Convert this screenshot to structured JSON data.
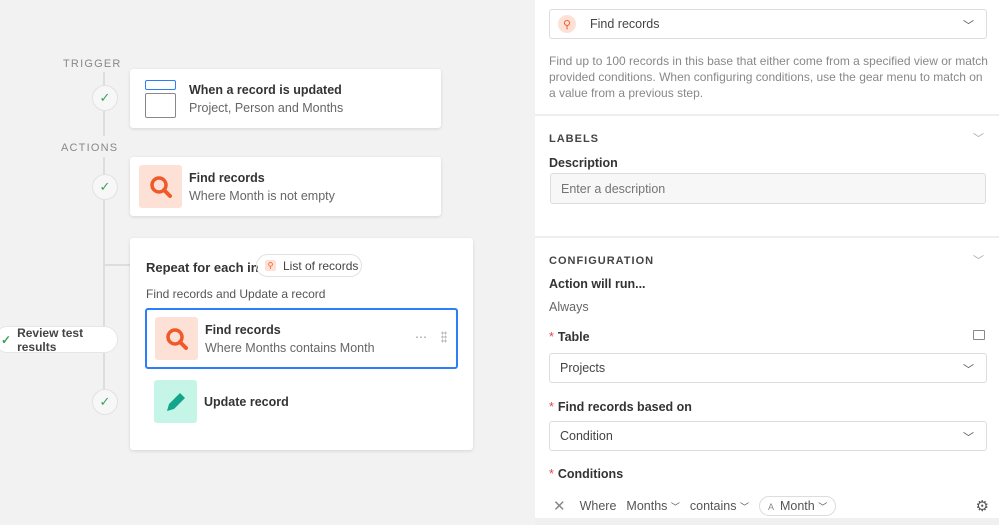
{
  "canvas": {
    "trigger_label": "TRIGGER",
    "actions_label": "ACTIONS",
    "trigger_card": {
      "title": "When a record is updated",
      "subtitle": "Project, Person and Months",
      "icon": "record-form-icon"
    },
    "find_card": {
      "title": "Find records",
      "subtitle": "Where Month is not empty",
      "icon": "search-icon"
    },
    "repeat_group": {
      "title": "Repeat for each in",
      "chip": "List of records",
      "description": "Find records and Update a record",
      "steps": [
        {
          "title": "Find records",
          "subtitle": "Where Months contains Month",
          "icon": "search-icon",
          "selected": true
        },
        {
          "title": "Update record",
          "icon": "pencil-icon"
        }
      ]
    },
    "review_button": "Review test results",
    "more_icon": "⋯"
  },
  "panel": {
    "action_type": {
      "value": "Find records",
      "icon": "search-icon"
    },
    "help_text": "Find up to 100 records in this base that either come from a specified view or match provided conditions. When configuring conditions, use the gear menu to match on a value from a previous step.",
    "labels": {
      "header": "LABELS",
      "description_label": "Description",
      "description_placeholder": "Enter a description"
    },
    "configuration": {
      "header": "CONFIGURATION",
      "run_label": "Action will run...",
      "run_value": "Always",
      "table_label": "Table",
      "table_value": "Projects",
      "based_on_label": "Find records based on",
      "based_on_value": "Condition",
      "conditions_label": "Conditions",
      "condition": {
        "where": "Where",
        "field": "Months",
        "operator": "contains",
        "value": "Month"
      }
    }
  },
  "colors": {
    "accent": "#2d7ff9",
    "search_bg": "#fde1d6",
    "search_fg": "#f0592a",
    "update_bg": "#c5f5e6",
    "update_fg": "#13a58a",
    "required": "#e0435b",
    "check": "#3aa35a"
  }
}
